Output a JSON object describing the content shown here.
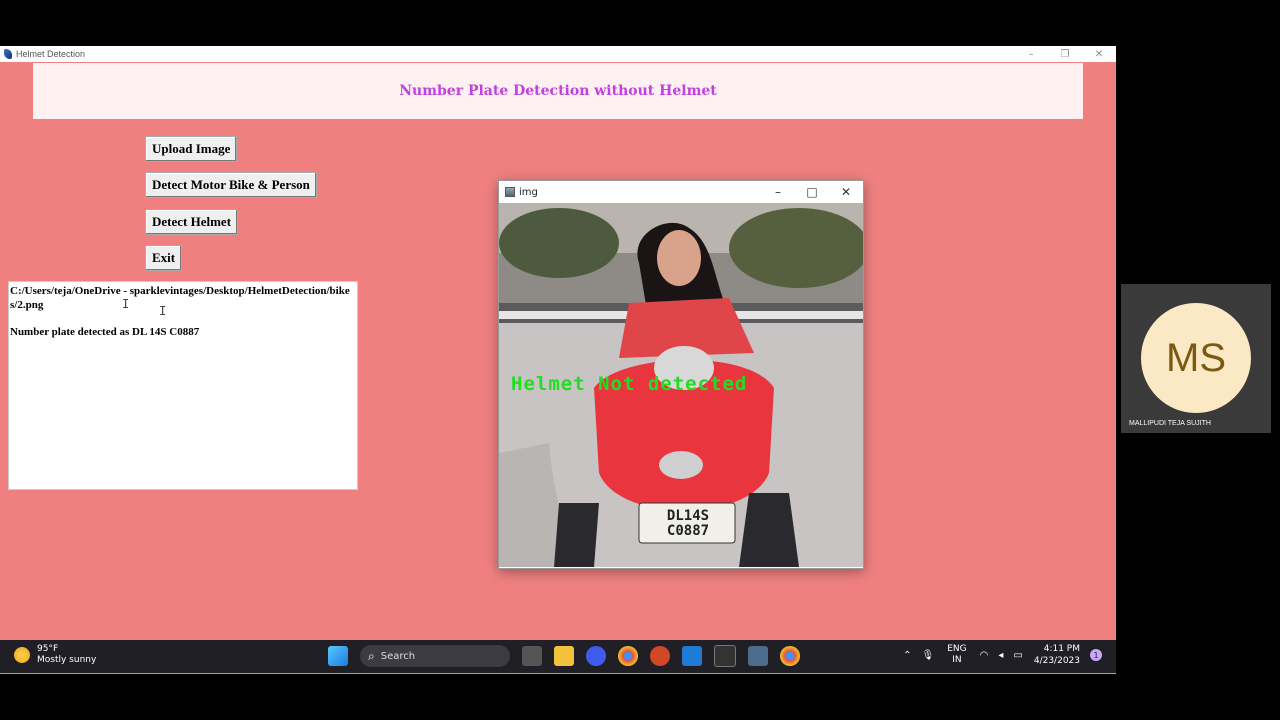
{
  "window": {
    "title": "Helmet Detection"
  },
  "heading": "Number Plate Detection without Helmet",
  "buttons": {
    "upload": "Upload Image",
    "detect_bike": "Detect Motor Bike & Person",
    "detect_helmet": "Detect Helmet",
    "exit": "Exit"
  },
  "output": {
    "path": "C:/Users/teja/OneDrive - sparklevintages/Desktop/HelmetDetection/bikes/2.png",
    "result": "Number plate detected as DL 14S C0887"
  },
  "image_window": {
    "title": "img",
    "overlay_text": "Helmet Not detected",
    "plate_line1": "DL14S",
    "plate_line2": "C0887"
  },
  "taskbar": {
    "temperature": "95°F",
    "weather": "Mostly sunny",
    "search_label": "Search",
    "lang_line1": "ENG",
    "lang_line2": "IN",
    "time": "4:11 PM",
    "date": "4/23/2023",
    "notification_count": "1"
  },
  "participant": {
    "initials": "MS",
    "name": "MALLIPUDI TEJA SUJITH",
    "avatar_color": "#fbe8c4"
  },
  "colors": {
    "background": "#f08080",
    "heading": "#c040e0",
    "overlay": "#22dd22"
  }
}
